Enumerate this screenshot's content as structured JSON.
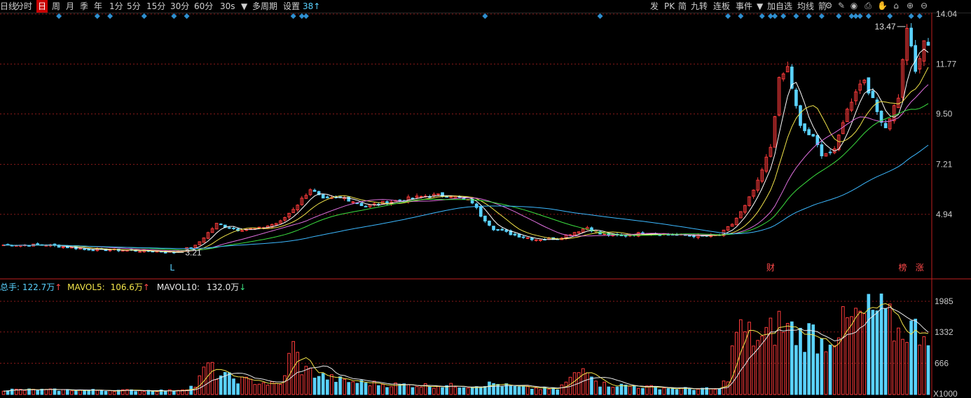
{
  "toolbar": {
    "left_items": [
      "日线",
      "分时",
      "日",
      "周",
      "月",
      "季",
      "年",
      "1分",
      "5分",
      "15分",
      "30分",
      "60分",
      "30s",
      "多周期",
      "设置"
    ],
    "active_item": "日",
    "settings_value": "38↑",
    "right_items": [
      "发",
      "PK",
      "简",
      "九转",
      "连板",
      "事件",
      "加自选",
      "均线",
      "箭"
    ],
    "right_icons": [
      "settings-gear-icon",
      "pen-icon",
      "eye-icon",
      "print-icon",
      "hand-icon",
      "lock-icon",
      "zoom-in-icon",
      "zoom-out-icon"
    ]
  },
  "colors": {
    "up": "#ff3b3b",
    "down": "#5ad2ff",
    "ma5": "#ffffff",
    "ma10": "#f2e44a",
    "ma20": "#e070e0",
    "ma30": "#3ce040",
    "ma60": "#3cb8ff",
    "grid": "#8b1a1a",
    "axis_text": "#c8c8c8",
    "event_marker": "#2e8fd0"
  },
  "chart_data": [
    {
      "type": "candlestick",
      "panel": "price",
      "y_ticks": [
        "14.04",
        "11.77",
        "9.50",
        "7.21",
        "4.94"
      ],
      "ylim": [
        2.2,
        14.04
      ],
      "x": {
        "start": 0,
        "end": 218
      },
      "grid": "horizontal dashed",
      "annotations": [
        {
          "label": "13.47",
          "x": 212,
          "value": 13.47,
          "kind": "high"
        },
        {
          "label": "3.21",
          "x": 40,
          "value": 3.21,
          "kind": "low"
        },
        {
          "label": "L",
          "x": 40,
          "kind": "marker"
        },
        {
          "label": "财",
          "x": 180,
          "kind": "marker"
        },
        {
          "label": "榜",
          "x": 211,
          "kind": "marker"
        },
        {
          "label": "涨",
          "x": 215,
          "kind": "marker"
        }
      ],
      "event_markers_x": [
        13,
        22,
        25,
        33,
        40,
        43,
        68,
        70,
        71,
        113,
        140,
        170,
        173,
        178,
        180,
        181,
        183,
        186,
        189,
        192,
        196,
        199,
        200,
        201,
        203,
        208,
        213,
        215
      ],
      "price_keypoints": [
        [
          0,
          3.55
        ],
        [
          10,
          3.55
        ],
        [
          20,
          3.35
        ],
        [
          30,
          3.3
        ],
        [
          40,
          3.22
        ],
        [
          45,
          3.5
        ],
        [
          50,
          4.5
        ],
        [
          55,
          4.25
        ],
        [
          60,
          4.3
        ],
        [
          65,
          4.6
        ],
        [
          69,
          5.4
        ],
        [
          72,
          6.1
        ],
        [
          75,
          5.6
        ],
        [
          80,
          5.7
        ],
        [
          85,
          5.3
        ],
        [
          90,
          5.5
        ],
        [
          95,
          5.65
        ],
        [
          100,
          5.8
        ],
        [
          105,
          5.8
        ],
        [
          110,
          5.5
        ],
        [
          112,
          4.9
        ],
        [
          115,
          4.3
        ],
        [
          120,
          4.0
        ],
        [
          125,
          3.8
        ],
        [
          130,
          3.85
        ],
        [
          135,
          4.2
        ],
        [
          137,
          4.35
        ],
        [
          140,
          4.05
        ],
        [
          145,
          3.95
        ],
        [
          150,
          4.1
        ],
        [
          160,
          3.98
        ],
        [
          165,
          3.95
        ],
        [
          168,
          4.0
        ],
        [
          171,
          4.5
        ],
        [
          174,
          5.3
        ],
        [
          177,
          6.4
        ],
        [
          180,
          8.0
        ],
        [
          182,
          11.0
        ],
        [
          184,
          11.6
        ],
        [
          187,
          8.9
        ],
        [
          190,
          8.4
        ],
        [
          192,
          7.7
        ],
        [
          195,
          7.8
        ],
        [
          197,
          9.2
        ],
        [
          200,
          10.6
        ],
        [
          202,
          11.1
        ],
        [
          205,
          9.6
        ],
        [
          207,
          8.9
        ],
        [
          210,
          10.3
        ],
        [
          212,
          13.47
        ],
        [
          214,
          11.4
        ],
        [
          216,
          12.7
        ]
      ],
      "moving_averages": [
        {
          "name": "MA5",
          "color": "#ffffff"
        },
        {
          "name": "MA10",
          "color": "#f2e44a"
        },
        {
          "name": "MA20",
          "color": "#e070e0"
        },
        {
          "name": "MA30",
          "color": "#3ce040"
        },
        {
          "name": "MA60",
          "color": "#3cb8ff"
        }
      ]
    },
    {
      "type": "bar",
      "panel": "volume",
      "series": [
        {
          "name": "总手",
          "value": "122.7万"
        }
      ],
      "overlays": [
        {
          "name": "MAVOL5",
          "value": "106.6万",
          "trend": "up"
        },
        {
          "name": "MAVOL10",
          "value": "132.0万",
          "trend": "down"
        }
      ],
      "y_ticks": [
        "1985",
        "1332",
        "666"
      ],
      "unit_label": "X1000",
      "ylim": [
        0,
        1985
      ],
      "volume_keypoints": [
        [
          0,
          100
        ],
        [
          20,
          90
        ],
        [
          40,
          80
        ],
        [
          45,
          180
        ],
        [
          48,
          650
        ],
        [
          50,
          420
        ],
        [
          55,
          320
        ],
        [
          60,
          260
        ],
        [
          65,
          200
        ],
        [
          68,
          1030
        ],
        [
          70,
          550
        ],
        [
          75,
          380
        ],
        [
          80,
          280
        ],
        [
          90,
          210
        ],
        [
          100,
          190
        ],
        [
          110,
          180
        ],
        [
          115,
          230
        ],
        [
          120,
          150
        ],
        [
          130,
          110
        ],
        [
          137,
          620
        ],
        [
          140,
          220
        ],
        [
          150,
          160
        ],
        [
          160,
          120
        ],
        [
          168,
          110
        ],
        [
          170,
          380
        ],
        [
          172,
          1400
        ],
        [
          175,
          1250
        ],
        [
          178,
          1150
        ],
        [
          180,
          1300
        ],
        [
          182,
          1500
        ],
        [
          184,
          1400
        ],
        [
          187,
          1250
        ],
        [
          190,
          1300
        ],
        [
          192,
          1100
        ],
        [
          195,
          1350
        ],
        [
          198,
          1500
        ],
        [
          200,
          1600
        ],
        [
          202,
          1650
        ],
        [
          204,
          1750
        ],
        [
          206,
          1700
        ],
        [
          208,
          1500
        ],
        [
          210,
          1300
        ],
        [
          212,
          1450
        ],
        [
          214,
          1350
        ],
        [
          216,
          1400
        ]
      ]
    }
  ],
  "legend": {
    "total_label": "总手:",
    "total_value": "122.7万",
    "total_arrow": "↑",
    "ma5_label": "MAVOL5:",
    "ma5_value": "106.6万",
    "ma5_arrow": "↑",
    "ma10_label": "MAVOL10:",
    "ma10_value": "132.0万",
    "ma10_arrow": "↓"
  }
}
